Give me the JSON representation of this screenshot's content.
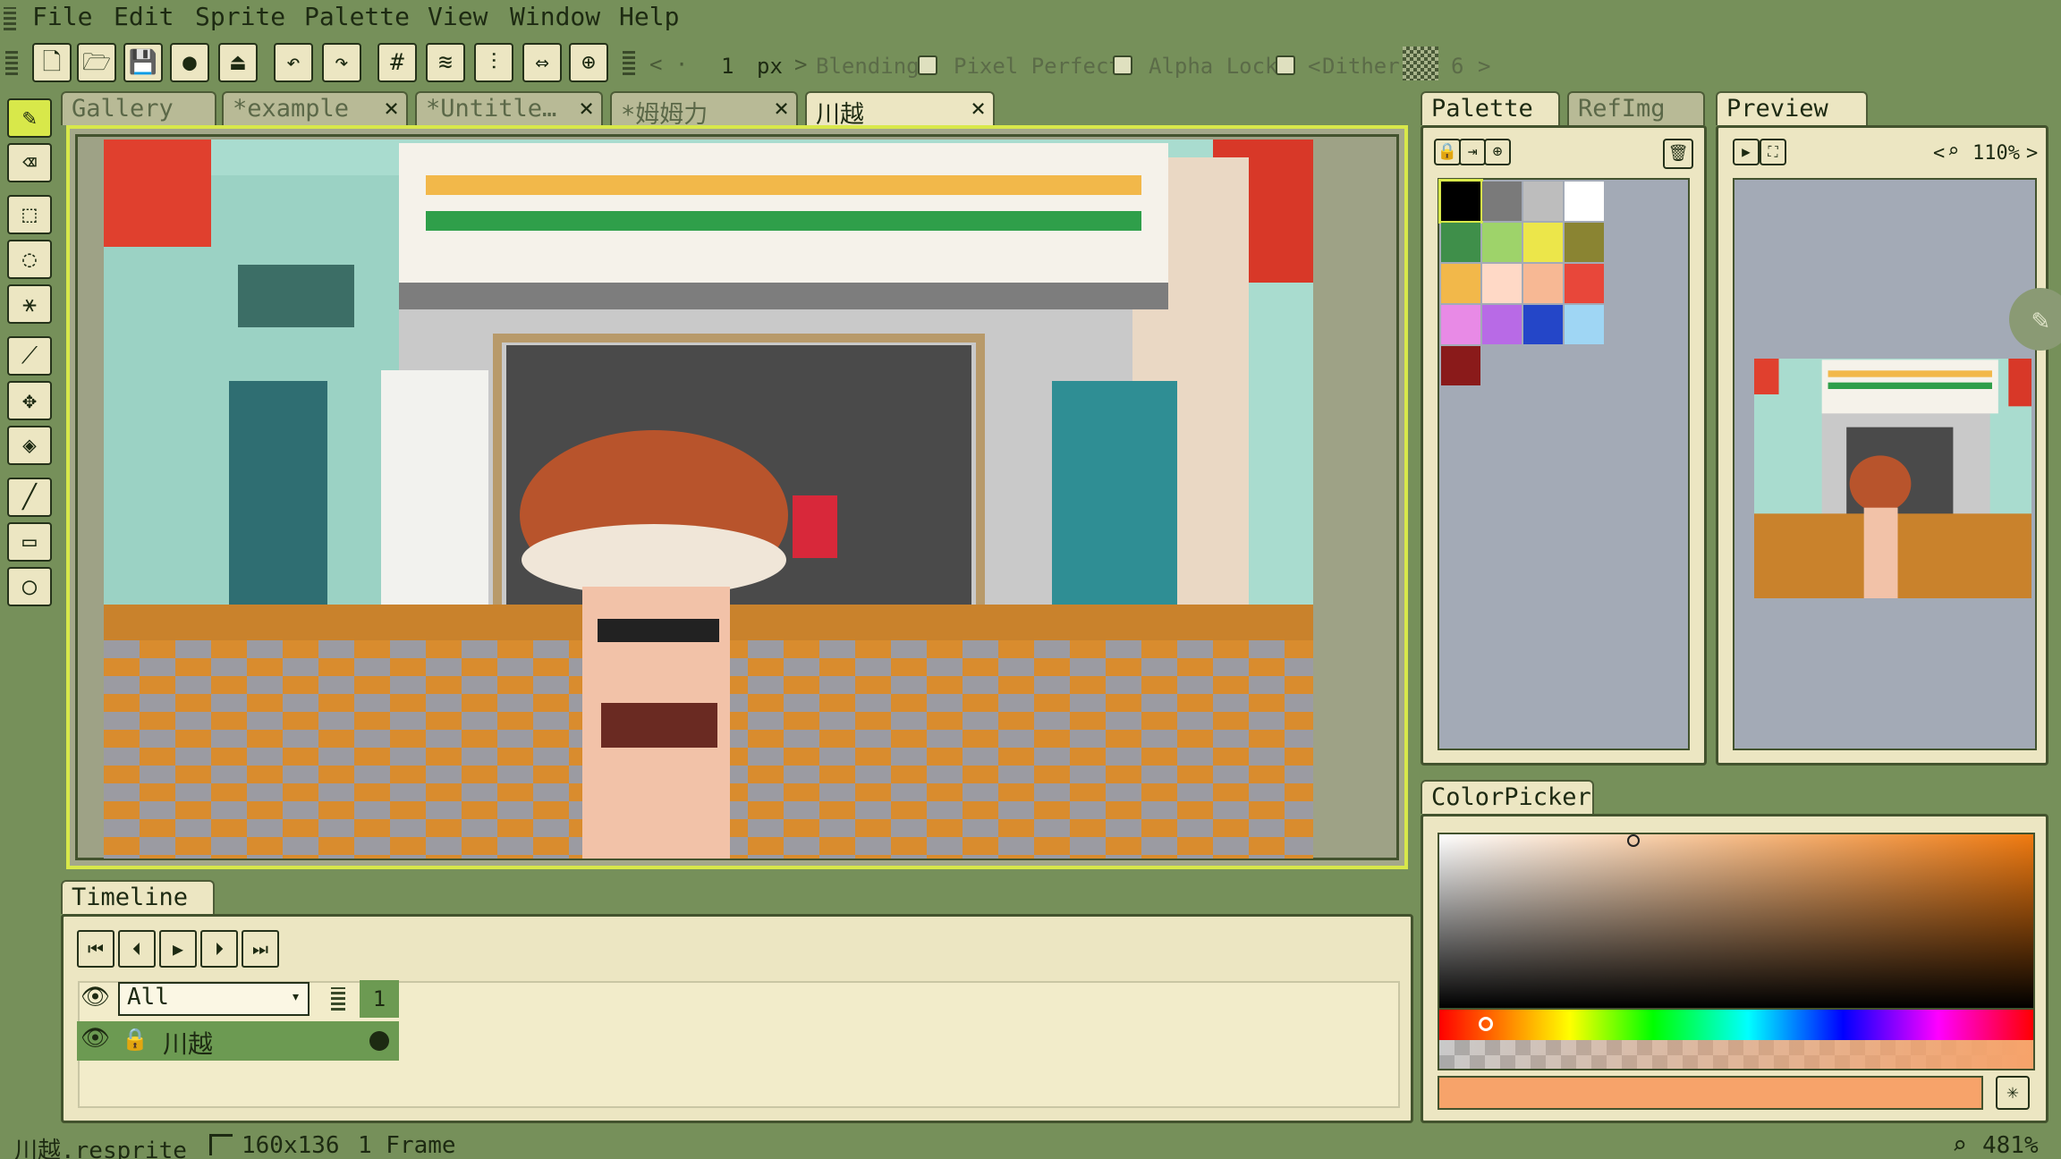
{
  "menu": {
    "items": [
      "File",
      "Edit",
      "Sprite",
      "Palette",
      "View",
      "Window",
      "Help"
    ]
  },
  "toolbar": {
    "frame_value": "1",
    "unit": "px",
    "blending_label": "Blending",
    "pixel_perfect_label": "Pixel Perfect",
    "alpha_lock_label": "Alpha Lock",
    "dither_label": "Dither",
    "dither_value": "6",
    "icons": [
      "new-file-icon",
      "open-folder-icon",
      "save-icon",
      "settings-circle-icon",
      "export-icon",
      "undo-icon",
      "redo-icon",
      "grid-icon",
      "layers-icon",
      "tune-icon",
      "symmetry-icon",
      "wrap-icon"
    ]
  },
  "tabs": [
    {
      "label": "Gallery",
      "closable": false
    },
    {
      "label": "*example",
      "closable": true
    },
    {
      "label": "*Untitle…",
      "closable": true
    },
    {
      "label": "*姆姆力",
      "closable": true
    },
    {
      "label": "川越",
      "closable": true,
      "active": true
    }
  ],
  "tools": [
    "pencil-icon",
    "eraser-icon",
    "rect-select-icon",
    "lasso-icon",
    "magic-wand-icon",
    "eyedropper-icon",
    "move-icon",
    "fill-bucket-icon",
    "line-icon",
    "rectangle-icon",
    "ellipse-icon"
  ],
  "palette_panel": {
    "tab_label": "Palette",
    "tab2_label": "RefImg",
    "colors": [
      "#000000",
      "#7a7a7a",
      "#bdbdbd",
      "#ffffff",
      "#3f8f4a",
      "#9ed36a",
      "#ece64a",
      "#8a8432",
      "#f2b84a",
      "#ffd9c6",
      "#f7b894",
      "#e8473a",
      "#e88ae6",
      "#b86ae6",
      "#2446c8",
      "#9fd6f4",
      "#8a1a1a"
    ]
  },
  "preview_panel": {
    "tab_label": "Preview",
    "zoom": "110%"
  },
  "colorpicker": {
    "tab_label": "ColorPicker",
    "accent": "#f7a36a"
  },
  "timeline": {
    "tab_label": "Timeline",
    "filter_value": "All",
    "frame_number": "1",
    "layer_name": "川越"
  },
  "status": {
    "filename": "川越.resprite",
    "size": "160x136",
    "frames": "1 Frame",
    "zoom": "481%"
  },
  "colors": {
    "app_bg": "#76905a",
    "panel_bg": "#ece6c2",
    "active_layer": "#6c9a52",
    "highlight": "#d8e84a"
  }
}
